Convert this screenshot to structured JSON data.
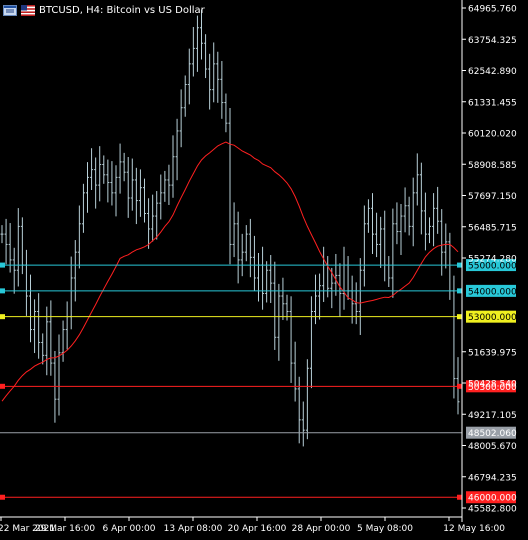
{
  "header": {
    "title": "BTCUSD, H4:  Bitcoin vs US Dollar"
  },
  "colors": {
    "background": "#000000",
    "candles": "#b8d0d8",
    "ma": "#ff2020",
    "axis": "#ffffff",
    "level_cyan": "#28c8d8",
    "level_yellow": "#f0f020",
    "level_red": "#ff2020",
    "level_gray": "#9aa0a8"
  },
  "axis": {
    "y_ticks": [
      "64965.760",
      "63754.325",
      "62542.890",
      "61331.455",
      "60120.020",
      "58908.585",
      "57697.150",
      "56485.715",
      "55274.280",
      "51639.975",
      "50428.540",
      "49217.105",
      "48005.670",
      "46794.235",
      "45582.800"
    ],
    "x_ticks": [
      "22 Mar 2021",
      "29 Mar 16:00",
      "6 Apr 00:00",
      "13 Apr 08:00",
      "20 Apr 16:00",
      "28 Apr 00:00",
      "5 May 08:00",
      "12 May 16:00"
    ]
  },
  "levels": [
    {
      "label": "55000.000",
      "color": "cyan"
    },
    {
      "label": "54000.000",
      "color": "cyan"
    },
    {
      "label": "53000.000",
      "color": "yellow"
    },
    {
      "label": "50300.000",
      "color": "red"
    },
    {
      "label": "48502.060",
      "color": "gray"
    },
    {
      "label": "46000.000",
      "color": "red"
    }
  ],
  "chart_data": {
    "type": "bar",
    "title": "BTCUSD, H4:  Bitcoin vs US Dollar",
    "ylim": [
      45582.8,
      64965.76
    ],
    "closes": [
      56200,
      55800,
      55200,
      54800,
      56500,
      55000,
      53800,
      52500,
      53200,
      52000,
      51500,
      52800,
      51200,
      49800,
      51600,
      52500,
      53000,
      54500,
      55500,
      56600,
      57800,
      58400,
      58700,
      58100,
      58900,
      58500,
      58200,
      57800,
      58400,
      59000,
      58600,
      57600,
      58300,
      57500,
      58000,
      57000,
      56400,
      56900,
      57400,
      57800,
      58300,
      58100,
      59200,
      60200,
      61100,
      62000,
      62800,
      63400,
      64200,
      63600,
      62600,
      61800,
      62800,
      62200,
      61300,
      60500,
      55800,
      56600,
      55200,
      55500,
      56200,
      55300,
      54500,
      55000,
      53900,
      54800,
      54300,
      52200,
      53800,
      53500,
      53200,
      51200,
      50200,
      49000,
      48600,
      51000,
      53200,
      53800,
      54200,
      55000,
      54100,
      54300,
      54600,
      53900,
      55000,
      54000,
      53500,
      53200,
      54800,
      56600,
      57200,
      56200,
      55800,
      56400,
      55000,
      54500,
      56600,
      56300,
      56900,
      57300,
      56500,
      57800,
      58500,
      57100,
      56200,
      56500,
      57200,
      56700,
      55500,
      55900,
      54000,
      50600,
      49700
    ]
  }
}
